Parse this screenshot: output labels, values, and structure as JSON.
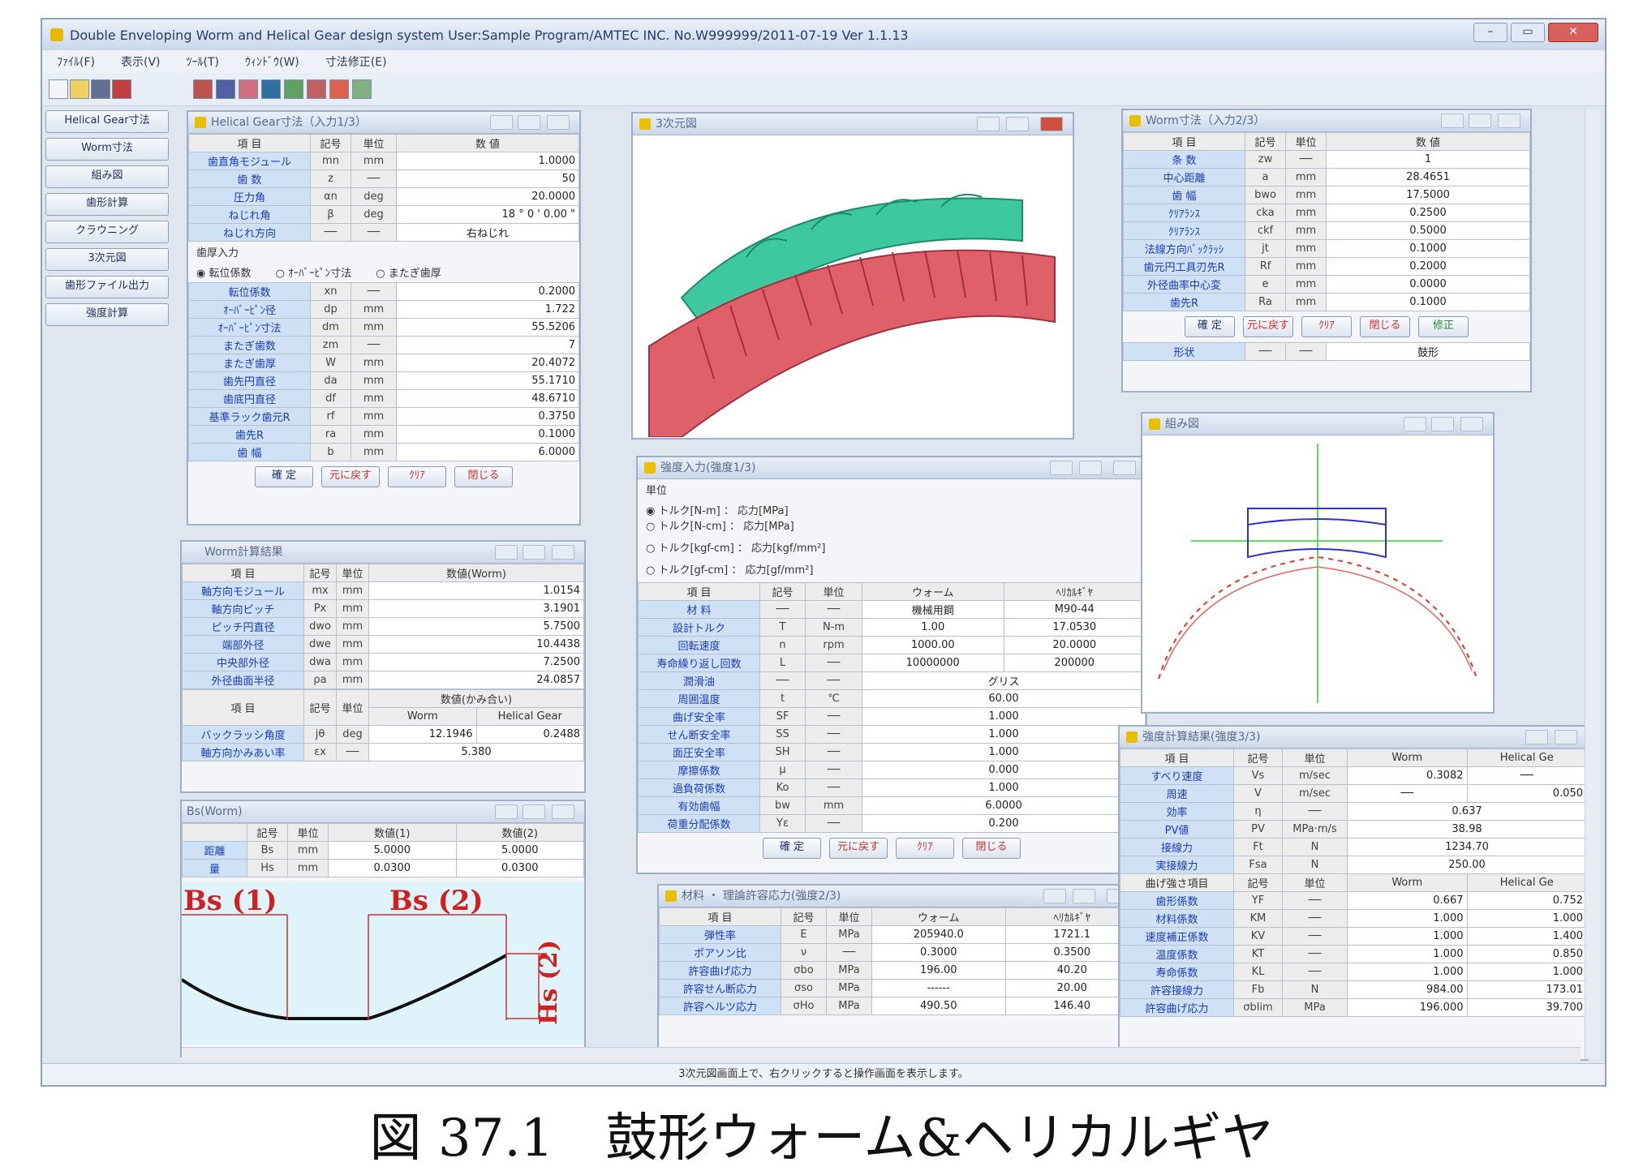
{
  "window": {
    "title": "Double Enveloping Worm and Helical Gear design system   User:Sample Program/AMTEC INC.   No.W999999/2011-07-19  Ver 1.1.13"
  },
  "menu": [
    "ﾌｧｲﾙ(F)",
    "表示(V)",
    "ﾂｰﾙ(T)",
    "ｳｨﾝﾄﾞｳ(W)",
    "寸法修正(E)"
  ],
  "side_buttons": [
    "Helical Gear寸法",
    "Worm寸法",
    "組み図",
    "歯形計算",
    "クラウニング",
    "3次元図",
    "歯形ファイル出力",
    "強度計算"
  ],
  "buttons": {
    "confirm": "確 定",
    "reset": "元に戻す",
    "clear": "ｸﾘｱ",
    "close": "閉じる",
    "shape": "形状"
  },
  "hg_panel": {
    "title": "Helical Gear寸法（入力1/3）",
    "headers": [
      "項 目",
      "記号",
      "単位",
      "数 値"
    ],
    "rows": [
      [
        "歯直角モジュール",
        "mn",
        "mm",
        "1.0000"
      ],
      [
        "歯 数",
        "z",
        "──",
        "50"
      ],
      [
        "圧力角",
        "αn",
        "deg",
        "20.0000"
      ],
      [
        "ねじれ角",
        "β",
        "deg",
        "18 ° 0 ' 0.00 \""
      ],
      [
        "ねじれ方向",
        "──",
        "──",
        "右ねじれ"
      ]
    ],
    "section": "歯厚入力",
    "radios": [
      "転位係数",
      "ｵｰﾊﾞｰﾋﾟﾝ寸法",
      "またぎ歯厚"
    ],
    "rows2": [
      [
        "転位係数",
        "xn",
        "──",
        "0.2000"
      ],
      [
        "ｵｰﾊﾞｰﾋﾟﾝ径",
        "dp",
        "mm",
        "1.722"
      ],
      [
        "ｵｰﾊﾞｰﾋﾟﾝ寸法",
        "dm",
        "mm",
        "55.5206"
      ],
      [
        "またぎ歯数",
        "zm",
        "──",
        "7"
      ],
      [
        "またぎ歯厚",
        "W",
        "mm",
        "20.4072"
      ],
      [
        "歯先円直径",
        "da",
        "mm",
        "55.1710"
      ],
      [
        "歯底円直径",
        "df",
        "mm",
        "48.6710"
      ],
      [
        "基準ラック歯元R",
        "rf",
        "mm",
        "0.3750"
      ],
      [
        "歯先R",
        "ra",
        "mm",
        "0.1000"
      ],
      [
        "歯 幅",
        "b",
        "mm",
        "6.0000"
      ]
    ]
  },
  "worm_calc": {
    "title": "Worm計算結果",
    "headers": [
      "項 目",
      "記号",
      "単位",
      "数値(Worm)"
    ],
    "rows": [
      [
        "軸方向モジュール",
        "mx",
        "mm",
        "1.0154"
      ],
      [
        "軸方向ピッチ",
        "Px",
        "mm",
        "3.1901"
      ],
      [
        "ピッチ円直径",
        "dwo",
        "mm",
        "5.7500"
      ],
      [
        "端部外径",
        "dwe",
        "mm",
        "10.4438"
      ],
      [
        "中央部外径",
        "dwa",
        "mm",
        "7.2500"
      ],
      [
        "外径曲面半径",
        "ρa",
        "mm",
        "24.0857"
      ]
    ],
    "headers2": [
      "項 目",
      "記号",
      "単位",
      "数値(かみ合い)"
    ],
    "subheaders": [
      "Worm",
      "Helical Gear"
    ],
    "rows2": [
      [
        "バックラッシ角度",
        "jθ",
        "deg",
        "12.1946",
        "0.2488"
      ],
      [
        "軸方向かみあい率",
        "εx",
        "──",
        "5.380",
        ""
      ]
    ]
  },
  "bs_panel": {
    "title": "Bs(Worm)",
    "headers": [
      "",
      "記号",
      "単位",
      "数値(1)",
      "数値(2)"
    ],
    "rows": [
      [
        "距離",
        "Bs",
        "mm",
        "5.0000",
        "5.0000"
      ],
      [
        "量",
        "Hs",
        "mm",
        "0.0300",
        "0.0300"
      ]
    ],
    "label1": "Bs (1)",
    "label2": "Bs (2)",
    "label3": "Hs (2)"
  },
  "view3d": {
    "title": "3次元図"
  },
  "worm_input": {
    "title": "Worm寸法（入力2/3）",
    "headers": [
      "項 目",
      "記号",
      "単位",
      "数 値"
    ],
    "rows": [
      [
        "条 数",
        "zw",
        "──",
        "1"
      ],
      [
        "中心距離",
        "a",
        "mm",
        "28.4651"
      ],
      [
        "歯 幅",
        "bwo",
        "mm",
        "17.5000"
      ],
      [
        "ｸﾘｱﾗﾝｽ",
        "cka",
        "mm",
        "0.2500"
      ],
      [
        "ｸﾘｱﾗﾝｽ",
        "ckf",
        "mm",
        "0.5000"
      ],
      [
        "法線方向ﾊﾞｯｸﾗｯｼ",
        "jt",
        "mm",
        "0.1000"
      ],
      [
        "歯元円工具刃先R",
        "Rf",
        "mm",
        "0.2000"
      ],
      [
        "外径曲率中心変",
        "e",
        "mm",
        "0.0000"
      ],
      [
        "歯先R",
        "Ra",
        "mm",
        "0.1000"
      ]
    ],
    "shape_value": "鼓形",
    "shape_extra": "修正"
  },
  "mesh": {
    "title": "組み図"
  },
  "strength_input": {
    "title": "強度入力(強度1/3)",
    "section": "単位",
    "radios": [
      "トルク[N-m] ： 応力[MPa]",
      "トルク[N-cm] ： 応力[MPa]",
      "トルク[kgf-cm] ： 応力[kgf/mm²]",
      "トルク[gf-cm] ： 応力[gf/mm²]"
    ],
    "headers": [
      "項 目",
      "記号",
      "単位",
      "ウォーム",
      "ﾍﾘｶﾙｷﾞﾔ"
    ],
    "rows": [
      [
        "材 料",
        "──",
        "──",
        "機械用鋼",
        "M90-44"
      ],
      [
        "設計トルク",
        "T",
        "N-m",
        "1.00",
        "17.0530"
      ],
      [
        "回転速度",
        "n",
        "rpm",
        "1000.00",
        "20.0000"
      ],
      [
        "寿命繰り返し回数",
        "L",
        "──",
        "10000000",
        "200000"
      ],
      [
        "潤滑油",
        "──",
        "──",
        "グリス",
        ""
      ],
      [
        "周囲温度",
        "t",
        "℃",
        "60.00",
        ""
      ],
      [
        "曲げ安全率",
        "SF",
        "──",
        "1.000",
        ""
      ],
      [
        "せん断安全率",
        "SS",
        "──",
        "1.000",
        ""
      ],
      [
        "面圧安全率",
        "SH",
        "──",
        "1.000",
        ""
      ],
      [
        "摩擦係数",
        "μ",
        "──",
        "0.000",
        ""
      ],
      [
        "過負荷係数",
        "Ko",
        "──",
        "1.000",
        ""
      ],
      [
        "有効歯幅",
        "bw",
        "mm",
        "6.0000",
        ""
      ],
      [
        "荷重分配係数",
        "Yε",
        "──",
        "0.200",
        ""
      ]
    ]
  },
  "material": {
    "title": "材料 ・ 理論許容応力(強度2/3)",
    "headers": [
      "項 目",
      "記号",
      "単位",
      "ウォーム",
      "ﾍﾘｶﾙｷﾞﾔ"
    ],
    "rows": [
      [
        "弾性率",
        "E",
        "MPa",
        "205940.0",
        "1721.1"
      ],
      [
        "ポアソン比",
        "ν",
        "──",
        "0.3000",
        "0.3500"
      ],
      [
        "許容曲げ応力",
        "σbo",
        "MPa",
        "196.00",
        "40.20"
      ],
      [
        "許容せん断応力",
        "σso",
        "MPa",
        "------",
        "20.00"
      ],
      [
        "許容ヘルツ応力",
        "σHo",
        "MPa",
        "490.50",
        "146.40"
      ]
    ]
  },
  "results": {
    "title": "強度計算結果(強度3/3)",
    "headers": [
      "項 目",
      "記号",
      "単位",
      "Worm",
      "Helical Ge"
    ],
    "rows": [
      [
        "すべり速度",
        "Vs",
        "m/sec",
        "0.3082",
        "──"
      ],
      [
        "周速",
        "V",
        "m/sec",
        "──",
        "0.050"
      ],
      [
        "効率",
        "η",
        "──",
        "0.637",
        ""
      ],
      [
        "PV値",
        "PV",
        "MPa·m/s",
        "38.98",
        ""
      ],
      [
        "接線力",
        "Ft",
        "N",
        "1234.70",
        ""
      ],
      [
        "実接線力",
        "Fsa",
        "N",
        "250.00",
        ""
      ]
    ],
    "headers2": [
      "曲げ強さ項目",
      "記号",
      "単位",
      "Worm",
      "Helical Ge"
    ],
    "rows2": [
      [
        "歯形係数",
        "YF",
        "──",
        "0.667",
        "0.752"
      ],
      [
        "材料係数",
        "KM",
        "──",
        "1.000",
        "1.000"
      ],
      [
        "速度補正係数",
        "KV",
        "──",
        "1.000",
        "1.400"
      ],
      [
        "温度係数",
        "KT",
        "──",
        "1.000",
        "0.850"
      ],
      [
        "寿命係数",
        "KL",
        "──",
        "1.000",
        "1.000"
      ],
      [
        "許容接線力",
        "Fb",
        "N",
        "984.00",
        "173.01"
      ],
      [
        "許容曲げ応力",
        "σblim",
        "MPa",
        "196.000",
        "39.700"
      ]
    ]
  },
  "status": "3次元図画面上で、右クリックすると操作画面を表示します。",
  "caption": "図 37.1　鼓形ウォーム&ヘリカルギヤ",
  "colors": {
    "gear": "#e0606a",
    "worm": "#3ec8a0",
    "label": "#1a3cc0",
    "accent_red": "#d03030"
  }
}
